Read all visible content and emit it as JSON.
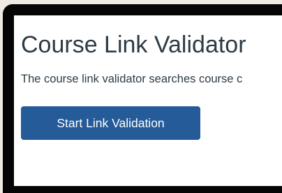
{
  "page": {
    "title": "Course Link Validator",
    "description": "The course link validator searches course c"
  },
  "actions": {
    "start_label": "Start Link Validation"
  },
  "colors": {
    "background": "#eee9e3",
    "device_bezel": "#050505",
    "text": "#2d3b45",
    "primary_button": "#255b98",
    "primary_button_text": "#ffffff"
  }
}
